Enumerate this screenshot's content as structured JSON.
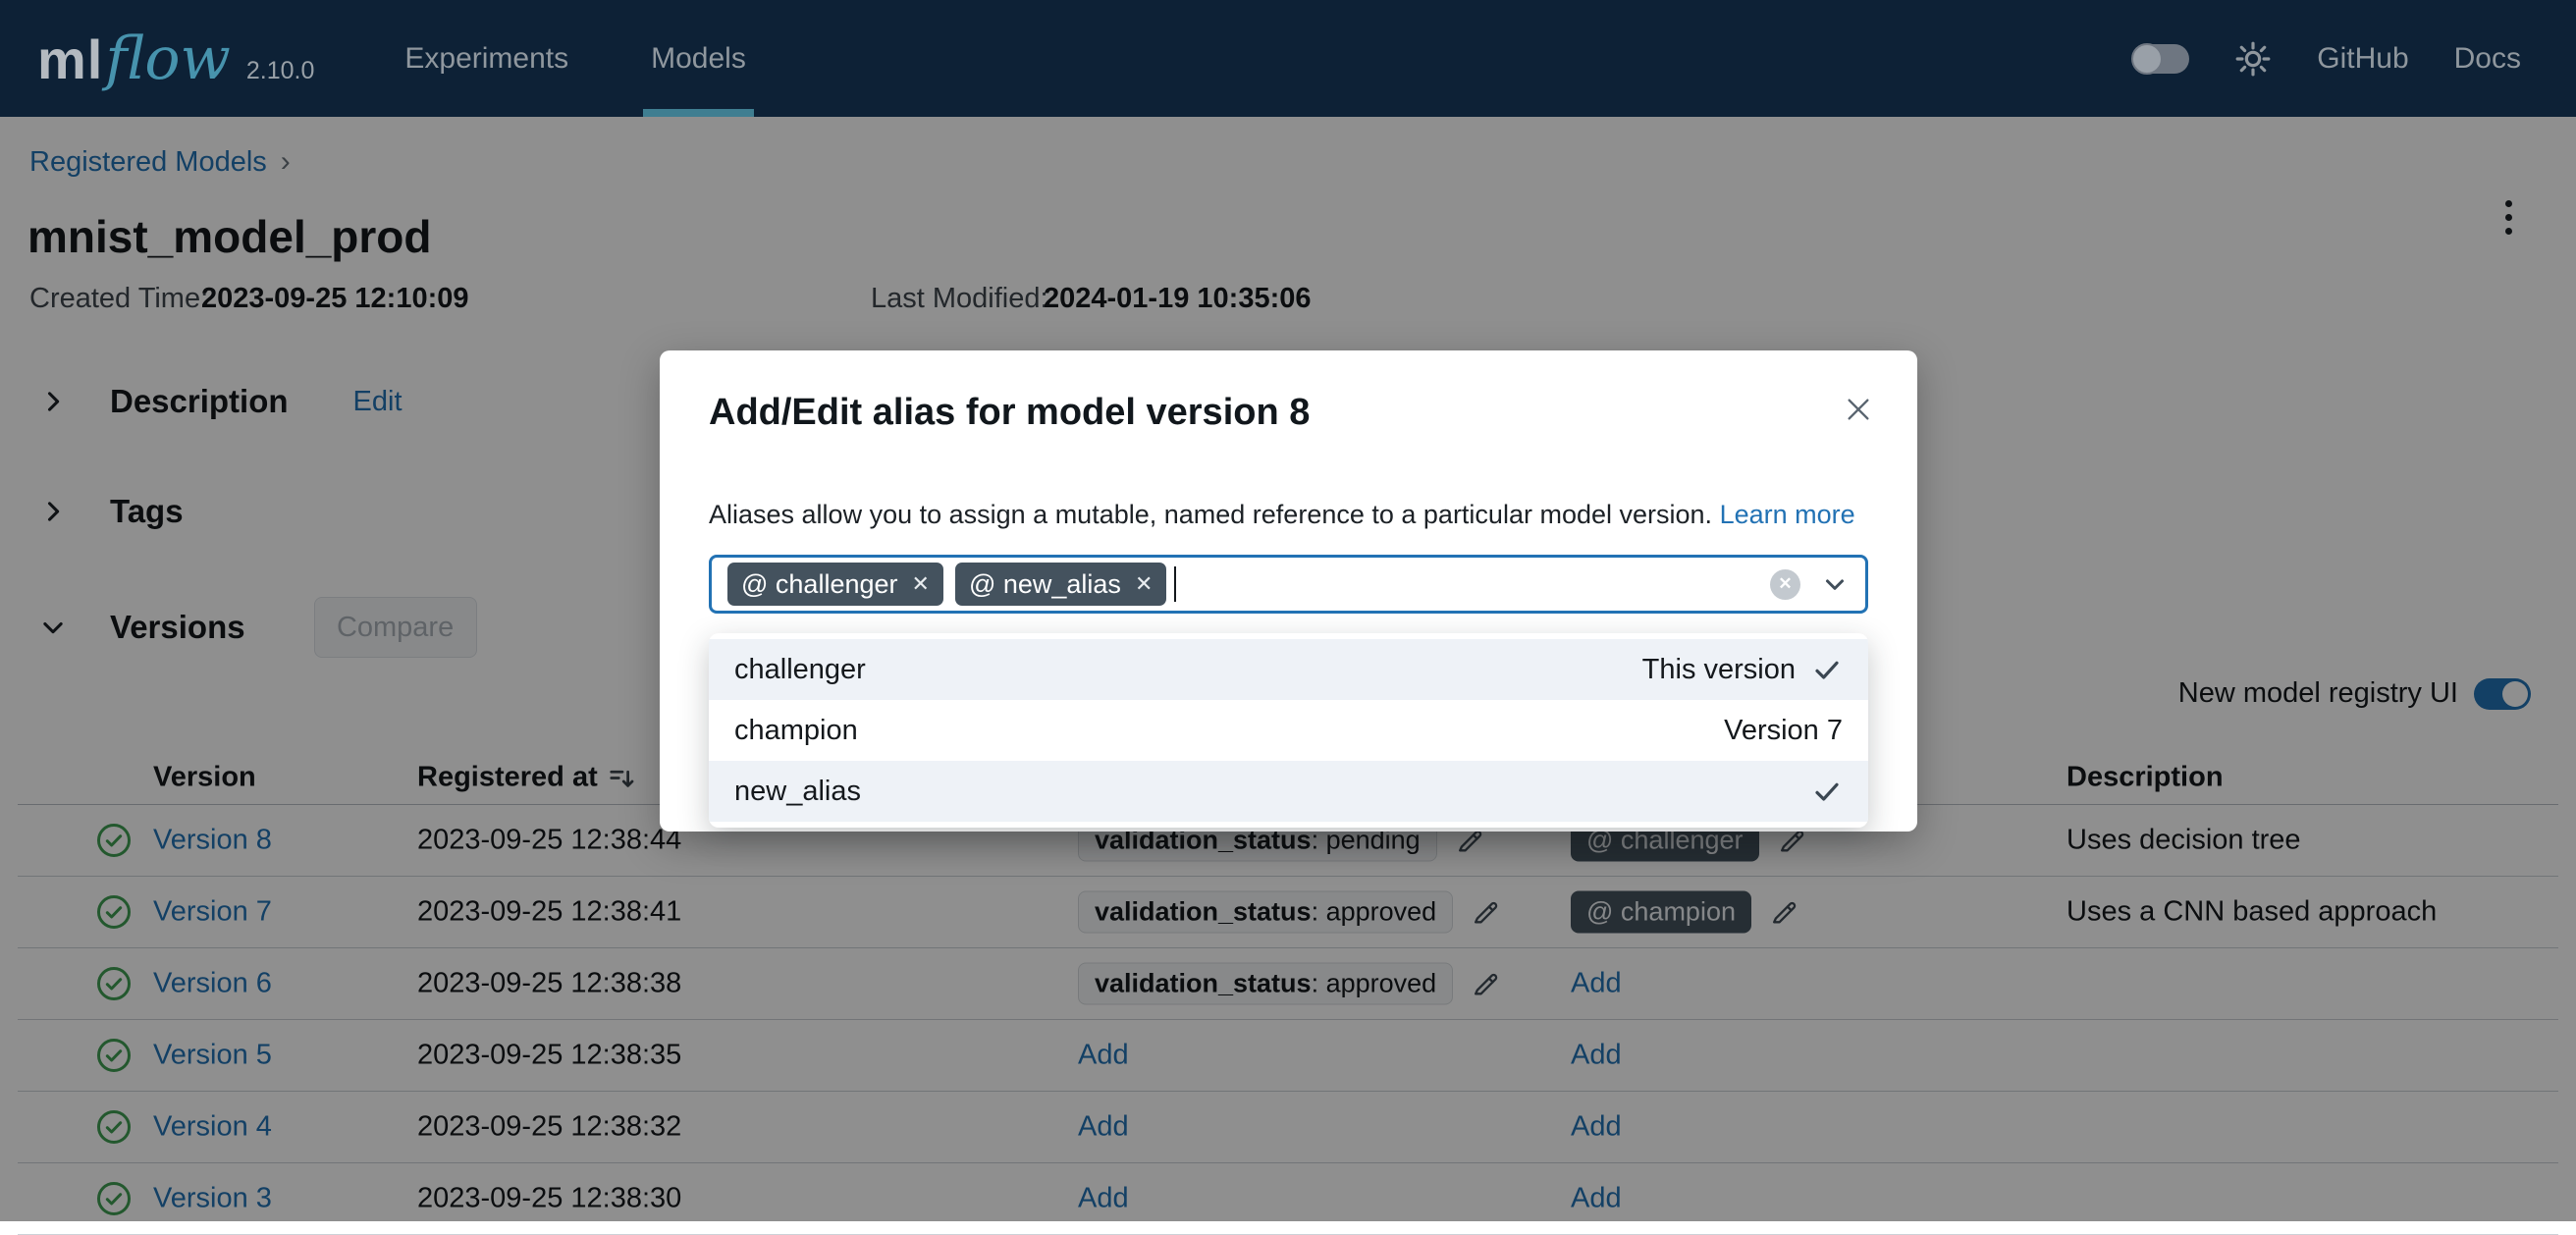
{
  "colors": {
    "accent": "#2272b4",
    "navy": "#0d2136",
    "teal": "#3f7e91",
    "alias": "#44525e",
    "green": "#3f9e52"
  },
  "navbar": {
    "logo": {
      "ml": "ml",
      "flow": "flow",
      "version": "2.10.0"
    },
    "links": [
      {
        "label": "Experiments",
        "active": false
      },
      {
        "label": "Models",
        "active": true
      }
    ],
    "right_links": [
      {
        "label": "GitHub"
      },
      {
        "label": "Docs"
      }
    ]
  },
  "breadcrumb": {
    "parent": "Registered Models",
    "separator": "›"
  },
  "page": {
    "title": "mnist_model_prod",
    "created_label": "Created Time:",
    "created": "2023-09-25 12:10:09",
    "modified_label": "Last Modified:",
    "modified": "2024-01-19 10:35:06"
  },
  "sections": {
    "description": {
      "label": "Description",
      "action": "Edit"
    },
    "tags": {
      "label": "Tags"
    },
    "versions": {
      "label": "Versions",
      "compare": "Compare"
    }
  },
  "registry_toggle": {
    "label": "New model registry UI",
    "on": true
  },
  "modal": {
    "title": "Add/Edit alias for model version 8",
    "description": "Aliases allow you to assign a mutable, named reference to a particular model version.",
    "learn_more": "Learn more",
    "alias_prefix": "@",
    "selected_aliases": [
      "challenger",
      "new_alias"
    ],
    "options": [
      {
        "name": "challenger",
        "right_label": "This version",
        "checked": true,
        "highlighted": true
      },
      {
        "name": "champion",
        "right_label": "Version 7",
        "checked": false,
        "highlighted": false
      },
      {
        "name": "new_alias",
        "right_label": "",
        "checked": true,
        "highlighted": true
      }
    ]
  },
  "table": {
    "headers": [
      "Version",
      "Registered at",
      "Description"
    ],
    "add_label": "Add",
    "alias_prefix": "@",
    "rows": [
      {
        "version": "Version 8",
        "registered": "2023-09-25 12:38:44",
        "tag_key": "validation_status",
        "tag_value": "pending",
        "aliases": [
          "challenger"
        ],
        "description": "Uses decision tree"
      },
      {
        "version": "Version 7",
        "registered": "2023-09-25 12:38:41",
        "tag_key": "validation_status",
        "tag_value": "approved",
        "aliases": [
          "champion"
        ],
        "description": "Uses a CNN based approach"
      },
      {
        "version": "Version 6",
        "registered": "2023-09-25 12:38:38",
        "tag_key": "validation_status",
        "tag_value": "approved",
        "aliases": [],
        "description": ""
      },
      {
        "version": "Version 5",
        "registered": "2023-09-25 12:38:35",
        "tag_key": "",
        "tag_value": "",
        "aliases": [],
        "description": ""
      },
      {
        "version": "Version 4",
        "registered": "2023-09-25 12:38:32",
        "tag_key": "",
        "tag_value": "",
        "aliases": [],
        "description": ""
      },
      {
        "version": "Version 3",
        "registered": "2023-09-25 12:38:30",
        "tag_key": "",
        "tag_value": "",
        "aliases": [],
        "description": ""
      }
    ]
  }
}
